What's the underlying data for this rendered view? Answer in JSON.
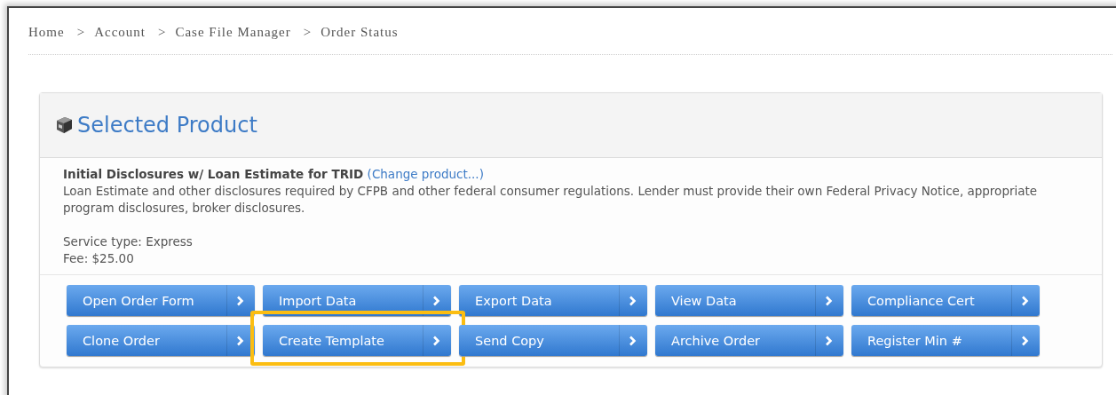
{
  "breadcrumb": [
    {
      "kind": "link",
      "text": "Home"
    },
    {
      "kind": "separator",
      "text": ">"
    },
    {
      "kind": "link",
      "text": "Account"
    },
    {
      "kind": "separator",
      "text": ">"
    },
    {
      "kind": "link",
      "text": "Case File Manager"
    },
    {
      "kind": "separator",
      "text": ">"
    },
    {
      "kind": "current",
      "text": "Order Status"
    }
  ],
  "panel": {
    "title": "Selected Product",
    "product_name": "Initial Disclosures w/ Loan Estimate for TRID",
    "change_link": "(Change product...)",
    "description": "Loan Estimate and other disclosures required by CFPB and other federal consumer regulations. Lender must provide their own Federal Privacy Notice, appropriate program disclosures, broker disclosures.",
    "service_type": "Service type: Express",
    "fee": "Fee: $25.00",
    "buttons": [
      {
        "label": "Open Order Form",
        "highlighted": false
      },
      {
        "label": "Import Data",
        "highlighted": false
      },
      {
        "label": "Export Data",
        "highlighted": false
      },
      {
        "label": "View Data",
        "highlighted": false
      },
      {
        "label": "Compliance Cert",
        "highlighted": false
      },
      {
        "label": "Clone Order",
        "highlighted": false
      },
      {
        "label": "Create Template",
        "highlighted": true
      },
      {
        "label": "Send Copy",
        "highlighted": false
      },
      {
        "label": "Archive Order",
        "highlighted": false
      },
      {
        "label": "Register Min #",
        "highlighted": false
      }
    ]
  }
}
